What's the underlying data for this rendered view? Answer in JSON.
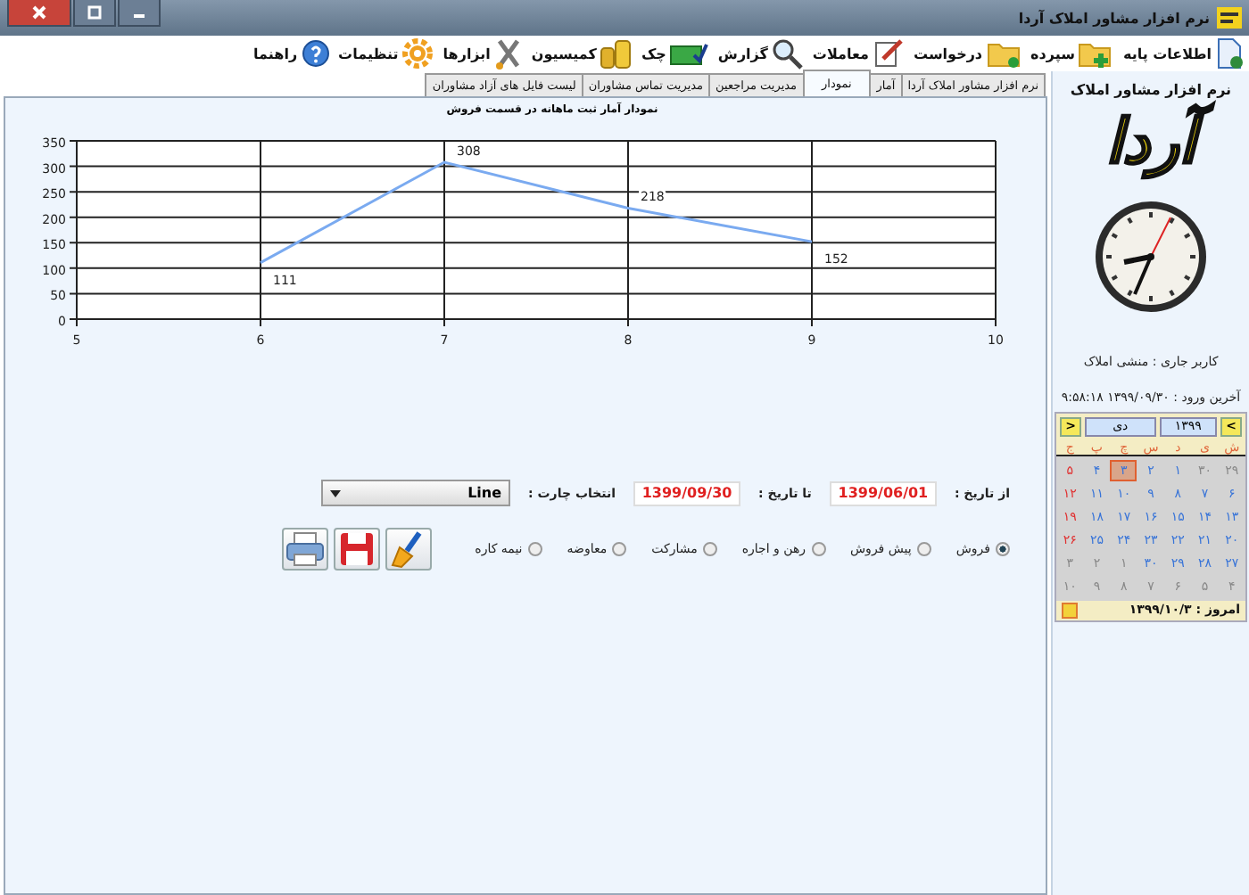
{
  "window": {
    "title": "نرم افزار مشاور املاک آردا"
  },
  "toolbar": [
    {
      "label": "اطلاعات پایه",
      "kind": "document"
    },
    {
      "label": "سپرده",
      "kind": "folder-add"
    },
    {
      "label": "درخواست",
      "kind": "folder"
    },
    {
      "label": "معاملات",
      "kind": "pen"
    },
    {
      "label": "گزارش",
      "kind": "search"
    },
    {
      "label": "چک",
      "kind": "cheque"
    },
    {
      "label": "کمیسیون",
      "kind": "coins"
    },
    {
      "label": "ابزارها",
      "kind": "tools"
    },
    {
      "label": "تنظیمات",
      "kind": "gear"
    },
    {
      "label": "راهنما",
      "kind": "help"
    }
  ],
  "tabs": [
    {
      "label": "نرم افزار مشاور املاک آردا",
      "selected": false
    },
    {
      "label": "آمار",
      "selected": false
    },
    {
      "label": "نمودار",
      "selected": true
    },
    {
      "label": "مدیریت مراجعین",
      "selected": false
    },
    {
      "label": "مدیریت تماس مشاوران",
      "selected": false
    },
    {
      "label": "لیست فایل های آزاد مشاوران",
      "selected": false
    }
  ],
  "chart": {
    "chart_data": {
      "type": "line",
      "title": "نمودار آمار ثبت ماهانه در قسمت فروش",
      "x": [
        6,
        7,
        8,
        9
      ],
      "series": [
        {
          "color": "#7aaaf0",
          "values": [
            111,
            308,
            218,
            152
          ]
        }
      ],
      "grid": true,
      "xlim": [
        5,
        10
      ],
      "ylim": [
        0,
        350
      ],
      "xticks": [
        5,
        6,
        7,
        8,
        9,
        10
      ],
      "yticks": [
        0,
        50,
        100,
        150,
        200,
        250,
        300,
        350
      ],
      "data_labels": true
    }
  },
  "form": {
    "from_label": "از تاریخ :",
    "from_date": "1399/06/01",
    "to_label": "تا تاریخ :",
    "to_date": "1399/09/30",
    "chart_label": "انتخاب چارت :",
    "chart_type": "Line",
    "options": [
      {
        "label": "فروش",
        "selected": true
      },
      {
        "label": "پیش فروش",
        "selected": false
      },
      {
        "label": "رهن و اجاره",
        "selected": false
      },
      {
        "label": "مشارکت",
        "selected": false
      },
      {
        "label": "معاوضه",
        "selected": false
      },
      {
        "label": "نیمه کاره",
        "selected": false
      }
    ]
  },
  "sidebar": {
    "title": "نرم افزار مشاور املاک",
    "logo": "آردا",
    "current_user": "کاربر جاری : منشی املاک",
    "last_login": "آخرین ورود : ۱۳۹۹/۰۹/۳۰ ۹:۵۸:۱۸",
    "calendar": {
      "prev": "<",
      "year": "۱۳۹۹",
      "month": "دی",
      "next": ">",
      "weekdays": [
        "ش",
        "ی",
        "د",
        "س",
        "چ",
        "پ",
        "ج"
      ],
      "weeks": [
        [
          {
            "day": "۲۹",
            "kind": "other",
            "selected": false
          },
          {
            "day": "۳۰",
            "kind": "other",
            "selected": false
          },
          {
            "day": "۱",
            "kind": "normal",
            "selected": false
          },
          {
            "day": "۲",
            "kind": "normal",
            "selected": false
          },
          {
            "day": "۳",
            "kind": "normal",
            "selected": true
          },
          {
            "day": "۴",
            "kind": "normal",
            "selected": false
          },
          {
            "day": "۵",
            "kind": "holiday",
            "selected": false
          }
        ],
        [
          {
            "day": "۶",
            "kind": "normal",
            "selected": false
          },
          {
            "day": "۷",
            "kind": "normal",
            "selected": false
          },
          {
            "day": "۸",
            "kind": "normal",
            "selected": false
          },
          {
            "day": "۹",
            "kind": "normal",
            "selected": false
          },
          {
            "day": "۱۰",
            "kind": "normal",
            "selected": false
          },
          {
            "day": "۱۱",
            "kind": "normal",
            "selected": false
          },
          {
            "day": "۱۲",
            "kind": "holiday",
            "selected": false
          }
        ],
        [
          {
            "day": "۱۳",
            "kind": "normal",
            "selected": false
          },
          {
            "day": "۱۴",
            "kind": "normal",
            "selected": false
          },
          {
            "day": "۱۵",
            "kind": "normal",
            "selected": false
          },
          {
            "day": "۱۶",
            "kind": "normal",
            "selected": false
          },
          {
            "day": "۱۷",
            "kind": "normal",
            "selected": false
          },
          {
            "day": "۱۸",
            "kind": "normal",
            "selected": false
          },
          {
            "day": "۱۹",
            "kind": "holiday",
            "selected": false
          }
        ],
        [
          {
            "day": "۲۰",
            "kind": "normal",
            "selected": false
          },
          {
            "day": "۲۱",
            "kind": "normal",
            "selected": false
          },
          {
            "day": "۲۲",
            "kind": "normal",
            "selected": false
          },
          {
            "day": "۲۳",
            "kind": "normal",
            "selected": false
          },
          {
            "day": "۲۴",
            "kind": "normal",
            "selected": false
          },
          {
            "day": "۲۵",
            "kind": "normal",
            "selected": false
          },
          {
            "day": "۲۶",
            "kind": "holiday",
            "selected": false
          }
        ],
        [
          {
            "day": "۲۷",
            "kind": "normal",
            "selected": false
          },
          {
            "day": "۲۸",
            "kind": "normal",
            "selected": false
          },
          {
            "day": "۲۹",
            "kind": "normal",
            "selected": false
          },
          {
            "day": "۳۰",
            "kind": "normal",
            "selected": false
          },
          {
            "day": "۱",
            "kind": "other",
            "selected": false
          },
          {
            "day": "۲",
            "kind": "other",
            "selected": false
          },
          {
            "day": "۳",
            "kind": "other",
            "selected": false
          }
        ],
        [
          {
            "day": "۴",
            "kind": "other",
            "selected": false
          },
          {
            "day": "۵",
            "kind": "other",
            "selected": false
          },
          {
            "day": "۶",
            "kind": "other",
            "selected": false
          },
          {
            "day": "۷",
            "kind": "other",
            "selected": false
          },
          {
            "day": "۸",
            "kind": "other",
            "selected": false
          },
          {
            "day": "۹",
            "kind": "other",
            "selected": false
          },
          {
            "day": "۱۰",
            "kind": "other",
            "selected": false
          }
        ]
      ],
      "today": "امروز : ۱۳۹۹/۱۰/۳"
    }
  }
}
